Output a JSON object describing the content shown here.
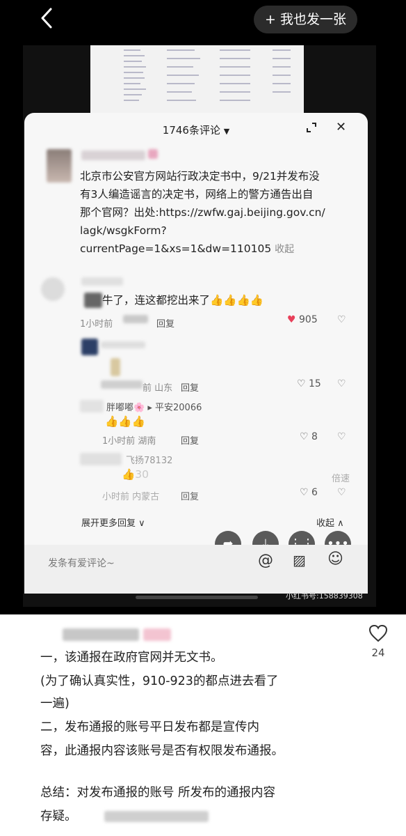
{
  "nav": {
    "back_icon": "chevron-left-icon",
    "post_button_label": "+ 我也发一张"
  },
  "comment_panel": {
    "count_label": "1746条评论",
    "caret": "▼",
    "expand_icon": "expand-icon",
    "close_glyph": "✕",
    "top_comment": {
      "lines": [
        "北京市公安官方网站行政决定书中，9/21并发布没",
        "有3人编造谣言的决定书，网络上的警方通告出自",
        "那个官网？出处:https://zwfw.gaj.beijing.gov.cn/",
        "lagk/wsgkForm?",
        "currentPage=1&xs=1&dw=110105"
      ],
      "collapse_label": "收起"
    },
    "replies": [
      {
        "text": "牛了，连这都挖出来了👍👍👍👍",
        "time": "1小时前",
        "reply_label": "回复",
        "likes": "905",
        "liked": true
      },
      {
        "text": "",
        "time": "前 山东",
        "reply_label": "回复",
        "likes": "15",
        "liked": false
      },
      {
        "name": "胖嘟嘟🌸",
        "target": "平安20066",
        "text": "👍👍👍",
        "time": "1小时前 湖南",
        "reply_label": "回复",
        "likes": "8",
        "liked": false
      },
      {
        "name": "飞扬78132",
        "text": "👍30",
        "time": "小时前 内蒙古",
        "reply_label": "回复",
        "likes": "6",
        "liked": false,
        "speed_label": "倍速"
      }
    ],
    "expand_more_label": "展开更多回复 ∨",
    "collapse_all_label": "收起 ∧",
    "input_placeholder": "发条有爱评论~"
  },
  "watermark": "小红书号:158839308",
  "caption": {
    "like_count": "24",
    "lines": [
      "一，该通报在政府官网并无文书。",
      "(为了确认真实性，910-923的都点进去看了",
      "一遍)",
      "二，发布通报的账号平日发布都是宣传内",
      "容，此通报内容该账号是否有权限发布通报。",
      "总结：对发布通报的账号 所发布的通报内容",
      "存疑。"
    ]
  },
  "colors": {
    "like_red": "#e8405a"
  }
}
